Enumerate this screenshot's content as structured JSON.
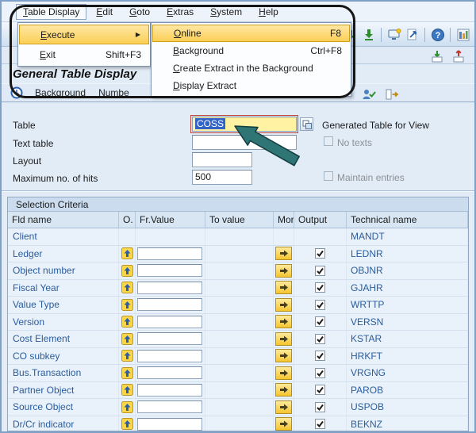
{
  "menubar": {
    "items": [
      "Table Display",
      "Edit",
      "Goto",
      "Extras",
      "System",
      "Help"
    ]
  },
  "menu": {
    "execute_label": "Execute",
    "exit_label": "Exit",
    "exit_shortcut": "Shift+F3",
    "submenu": [
      {
        "label": "Online",
        "shortcut": "F8"
      },
      {
        "label": "Background",
        "shortcut": "Ctrl+F8"
      },
      {
        "label": "Create Extract in the Background",
        "shortcut": ""
      },
      {
        "label": "Display Extract",
        "shortcut": ""
      }
    ]
  },
  "page": {
    "title": "General Table Display"
  },
  "app_toolbar": {
    "background": "Background",
    "number_of_entries": "Numbe"
  },
  "form": {
    "table_label": "Table",
    "table_value": "COSS",
    "text_table_label": "Text table",
    "layout_label": "Layout",
    "max_hits_label": "Maximum no. of hits",
    "max_hits_value": "500",
    "generated_view_label": "Generated Table for View",
    "no_texts_label": "No texts",
    "maintain_entries_label": "Maintain entries"
  },
  "selection": {
    "header": "Selection Criteria",
    "columns": [
      "Fld name",
      "O.",
      "Fr.Value",
      "To value",
      "More",
      "Output",
      "Technical name"
    ],
    "rows": [
      {
        "field": "Client",
        "tech": "MANDT",
        "controls": false,
        "output": false
      },
      {
        "field": "Ledger",
        "tech": "LEDNR",
        "controls": true,
        "output": true
      },
      {
        "field": "Object number",
        "tech": "OBJNR",
        "controls": true,
        "output": true
      },
      {
        "field": "Fiscal Year",
        "tech": "GJAHR",
        "controls": true,
        "output": true
      },
      {
        "field": "Value Type",
        "tech": "WRTTP",
        "controls": true,
        "output": true
      },
      {
        "field": "Version",
        "tech": "VERSN",
        "controls": true,
        "output": true
      },
      {
        "field": "Cost Element",
        "tech": "KSTAR",
        "controls": true,
        "output": true
      },
      {
        "field": "CO subkey",
        "tech": "HRKFT",
        "controls": true,
        "output": true
      },
      {
        "field": "Bus.Transaction",
        "tech": "VRGNG",
        "controls": true,
        "output": true
      },
      {
        "field": "Partner Object",
        "tech": "PAROB",
        "controls": true,
        "output": true
      },
      {
        "field": "Source Object",
        "tech": "USPOB",
        "controls": true,
        "output": true
      },
      {
        "field": "Dr/Cr indicator",
        "tech": "BEKNZ",
        "controls": true,
        "output": true
      }
    ]
  },
  "glyphs": {
    "submenu_arrow": "▶"
  },
  "colors": {
    "highlight_gold": "#fbcf56",
    "selection_blue": "#3264c8",
    "field_yellow": "#fff3a3",
    "link_blue": "#2a5d9e",
    "arrow_teal": "#2f7576",
    "callout_black": "#161616"
  },
  "icons": {
    "toolbar_main": [
      "page-first",
      "page-up",
      "page-down",
      "page-last",
      "new-session",
      "create-shortcut",
      "help",
      "customize"
    ],
    "toolbar_secondary": [
      "import",
      "export"
    ],
    "app_toolbar": [
      "clock",
      "user-check",
      "layout-arrow"
    ],
    "field": [
      "matchcode"
    ],
    "grid": [
      "selection-options",
      "more-arrow",
      "checked-checkbox"
    ]
  }
}
